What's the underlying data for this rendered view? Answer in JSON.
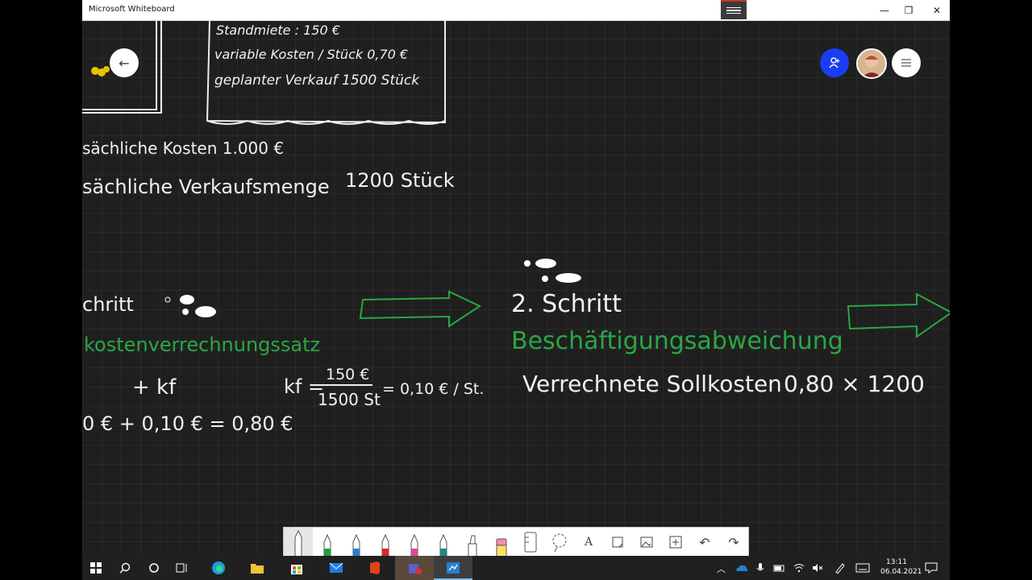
{
  "app": {
    "title": "Microsoft Whiteboard",
    "window_controls": {
      "minimize": "—",
      "maximize": "❐",
      "close": "✕"
    }
  },
  "board": {
    "top_box": {
      "line1": "Standmiete :   150 €",
      "line2": "variable Kosten / Stück   0,70 €",
      "line3": "geplanter Verkauf   1500 Stück"
    },
    "actual_costs": "sächliche Kosten      1.000 €",
    "actual_quantity": "sächliche Verkaufsmenge",
    "actual_quantity_value": "1200 Stück",
    "step1": {
      "heading": "chritt",
      "subheading": "kostenverrechnungssatz",
      "formula_left": "+  kf",
      "formula_kf": "kf =",
      "fraction_num": "150 €",
      "fraction_den": "1500 St",
      "formula_result": "= 0,10 € / St.",
      "line2": "0 €   +  0,10 €  =  0,80 €"
    },
    "step2": {
      "heading": "2. Schritt",
      "subheading": "Beschäftigungsabweichung",
      "line1": "Verrechnete Sollkosten",
      "line1_value": "0,80 × 1200"
    }
  },
  "colors": {
    "board_bg": "#1f1f1f",
    "ink_white": "#f1f1f1",
    "ink_green": "#29a745",
    "accent_blue": "#1a3cf5"
  },
  "taskbar": {
    "time": "13:11",
    "date": "06.04.2021"
  }
}
